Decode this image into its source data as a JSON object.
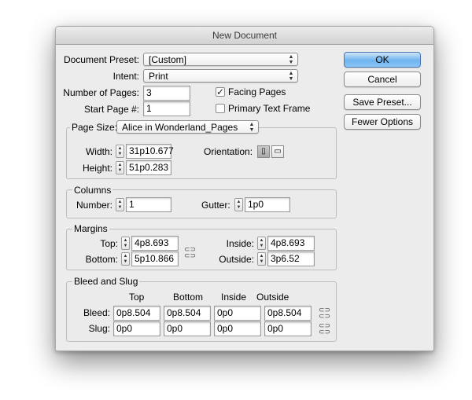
{
  "window": {
    "title": "New Document"
  },
  "document": {
    "preset_label": "Document Preset:",
    "preset_value": "[Custom]",
    "intent_label": "Intent:",
    "intent_value": "Print",
    "pages_label": "Number of Pages:",
    "pages_value": "3",
    "start_label": "Start Page #:",
    "start_value": "1",
    "facing_pages_label": "Facing Pages",
    "facing_pages_checked": true,
    "primary_text_label": "Primary Text Frame",
    "primary_text_checked": false
  },
  "page_size": {
    "label": "Page Size:",
    "value": "Alice in Wonderland_Pages",
    "width_label": "Width:",
    "width_value": "31p10.677",
    "height_label": "Height:",
    "height_value": "51p0.283",
    "orientation_label": "Orientation:",
    "orientation_selected": "portrait"
  },
  "columns": {
    "title": "Columns",
    "number_label": "Number:",
    "number_value": "1",
    "gutter_label": "Gutter:",
    "gutter_value": "1p0"
  },
  "margins": {
    "title": "Margins",
    "top_label": "Top:",
    "top_value": "4p8.693",
    "bottom_label": "Bottom:",
    "bottom_value": "5p10.866",
    "inside_label": "Inside:",
    "inside_value": "4p8.693",
    "outside_label": "Outside:",
    "outside_value": "3p6.52"
  },
  "bleed_slug": {
    "title": "Bleed and Slug",
    "headers": [
      "Top",
      "Bottom",
      "Inside",
      "Outside"
    ],
    "bleed_label": "Bleed:",
    "bleed_values": [
      "0p8.504",
      "0p8.504",
      "0p0",
      "0p8.504"
    ],
    "slug_label": "Slug:",
    "slug_values": [
      "0p0",
      "0p0",
      "0p0",
      "0p0"
    ]
  },
  "buttons": {
    "ok": "OK",
    "cancel": "Cancel",
    "save_preset": "Save Preset...",
    "fewer_options": "Fewer Options"
  },
  "icons": {
    "popup_arrows": "up-down-arrows-icon",
    "spinner": "stepper-icon",
    "chain": "chain-link-icon",
    "portrait": "portrait-orientation-icon",
    "landscape": "landscape-orientation-icon"
  },
  "colors": {
    "default_button": "#6fb3ee"
  }
}
